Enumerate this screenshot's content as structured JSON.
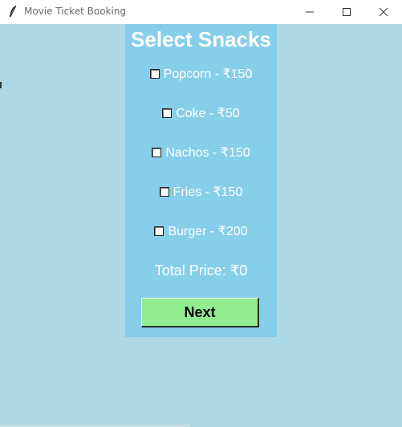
{
  "window": {
    "title": "Movie Ticket Booking",
    "background": "#add8e6",
    "panel_color": "#87ceeb"
  },
  "controls": {
    "minimize_icon": "minimize-icon",
    "maximize_icon": "maximize-icon",
    "close_icon": "close-icon"
  },
  "main": {
    "heading": "Select Snacks",
    "snacks": [
      {
        "label": "Popcorn - ₹150",
        "checked": false
      },
      {
        "label": "Coke - ₹50",
        "checked": false
      },
      {
        "label": "Nachos - ₹150",
        "checked": false
      },
      {
        "label": "Fries - ₹150",
        "checked": false
      },
      {
        "label": "Burger - ₹200",
        "checked": false
      }
    ],
    "total_label": "Total Price: ₹0",
    "next_label": "Next",
    "next_color": "#90ee90"
  }
}
